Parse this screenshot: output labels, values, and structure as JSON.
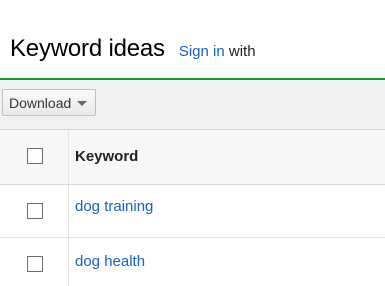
{
  "header": {
    "title": "Keyword ideas",
    "sign_in_link": "Sign in",
    "sign_in_suffix": "with"
  },
  "toolbar": {
    "download_label": "Download"
  },
  "colors": {
    "accent_green": "#159a37",
    "link_blue": "#1a5fc9"
  },
  "table": {
    "column_header": "Keyword",
    "rows": [
      {
        "keyword": "dog training"
      },
      {
        "keyword": "dog health"
      }
    ]
  }
}
